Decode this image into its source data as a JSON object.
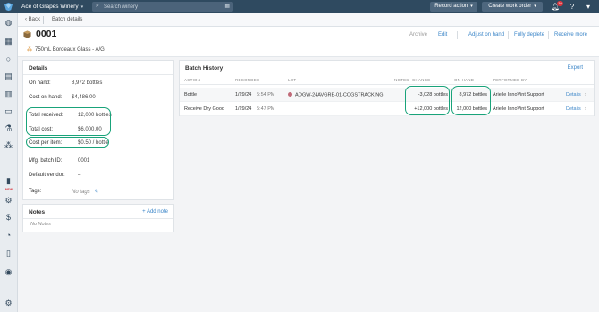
{
  "topbar": {
    "winery_name": "Ace of Grapes Winery",
    "search_placeholder": "Search winery",
    "record_action_label": "Record action",
    "create_work_order_label": "Create work order",
    "notification_count": "10",
    "colors": {
      "bar": "#2f4a60",
      "button": "#4e677e"
    }
  },
  "sidebar": {
    "icons": [
      "barrel-icon",
      "calendar-icon",
      "circle-icon",
      "clipboard-icon",
      "tank-icon",
      "box-icon",
      "flask-icon",
      "barrels-icon",
      "chart-icon",
      "gears-icon",
      "dollar-icon",
      "gauge-icon",
      "bottle-icon",
      "eye-icon",
      "settings-icon"
    ],
    "new_label": "NEW"
  },
  "breadcrumb": {
    "back_label": "Back",
    "current": "Batch details"
  },
  "header": {
    "lot_id": "0001",
    "subtitle": "750mL Bordeaux Glass - A/G",
    "actions": {
      "archive": "Archive",
      "edit": "Edit",
      "adjust_on_hand": "Adjust on hand",
      "fully_deplete": "Fully deplete",
      "receive_more": "Receive more"
    }
  },
  "details": {
    "title": "Details",
    "on_hand_label": "On hand:",
    "on_hand_value": "8,972 bottles",
    "cost_on_hand_label": "Cost on hand:",
    "cost_on_hand_value": "$4,486.00",
    "total_received_label": "Total received:",
    "total_received_value": "12,000 bottles",
    "total_cost_label": "Total cost:",
    "total_cost_value": "$6,000.00",
    "cost_per_item_label": "Cost per item:",
    "cost_per_item_value": "$0.50 / bottle",
    "mfg_batch_label": "Mfg. batch ID:",
    "mfg_batch_value": "0001",
    "default_vendor_label": "Default vendor:",
    "default_vendor_value": "–",
    "tags_label": "Tags:",
    "tags_value": "No tags"
  },
  "notes": {
    "title": "Notes",
    "add_label": "+ Add note",
    "empty": "No Notes"
  },
  "batch_history": {
    "title": "Batch History",
    "export_label": "Export",
    "columns": [
      "ACTION",
      "RECORDED",
      "LOT",
      "NOTES",
      "CHANGE",
      "ON HAND",
      "PERFORMED BY"
    ],
    "rows": [
      {
        "action": "Bottle",
        "date": "1/29/24",
        "time": "5:54 PM",
        "lot": "AOGW-24AVGRE-01-COGSTRACKING",
        "notes": "",
        "change": "-3,028 bottles",
        "on_hand": "8,972 bottles",
        "performed_by": "Arielle InnoVint Support",
        "details_label": "Details"
      },
      {
        "action": "Receive Dry Good",
        "date": "1/29/24",
        "time": "5:47 PM",
        "lot": "",
        "notes": "",
        "change": "+12,000 bottles",
        "on_hand": "12,000 bottles",
        "performed_by": "Arielle InnoVint Support",
        "details_label": "Details"
      }
    ]
  },
  "highlight_color": "#19a37a"
}
